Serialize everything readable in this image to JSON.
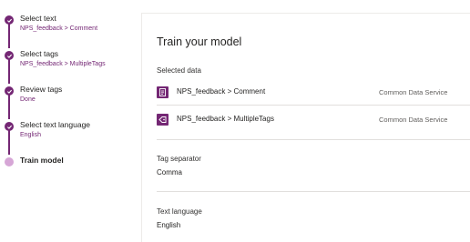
{
  "stepper": {
    "steps": [
      {
        "title": "Select text",
        "subtitle": "NPS_feedback > Comment",
        "state": "done"
      },
      {
        "title": "Select tags",
        "subtitle": "NPS_feedback > MultipleTags",
        "state": "done"
      },
      {
        "title": "Review tags",
        "subtitle": "Done",
        "state": "done"
      },
      {
        "title": "Select text language",
        "subtitle": "English",
        "state": "done"
      },
      {
        "title": "Train model",
        "subtitle": "",
        "state": "current"
      }
    ]
  },
  "main": {
    "title": "Train your model",
    "selected_data_label": "Selected data",
    "rows": [
      {
        "name": "NPS_feedback > Comment",
        "source": "Common Data Service",
        "icon": "text-field-icon"
      },
      {
        "name": "NPS_feedback > MultipleTags",
        "source": "Common Data Service",
        "icon": "tag-field-icon"
      }
    ],
    "tag_separator_label": "Tag separator",
    "tag_separator_value": "Comma",
    "text_language_label": "Text language",
    "text_language_value": "English"
  },
  "colors": {
    "accent": "#742774",
    "current_step": "#d6a6d6",
    "divider": "#e1dfdd"
  }
}
